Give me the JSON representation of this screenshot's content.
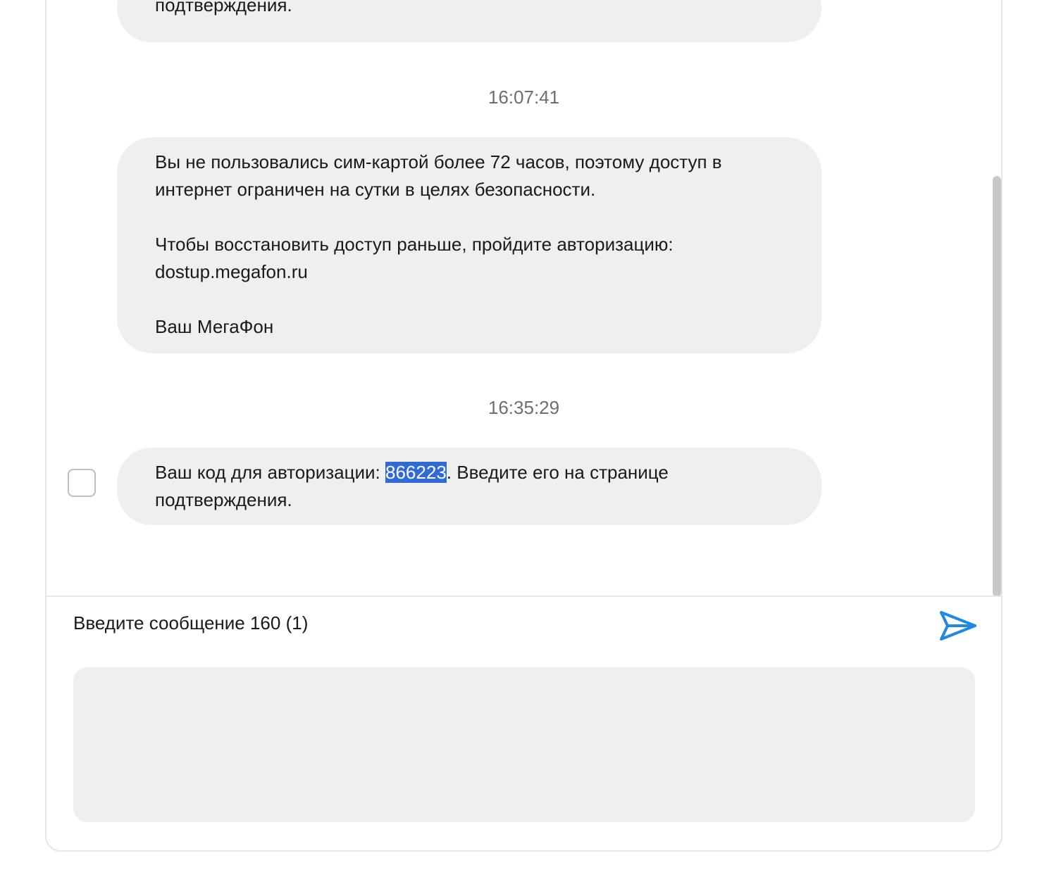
{
  "messages": [
    {
      "text": "подтверждения."
    },
    {
      "timestamp": "16:07:41",
      "paragraphs": [
        "Вы не пользовались сим-картой более 72 часов, поэтому доступ в интернет ограничен на сутки в целях безопасности.",
        "Чтобы восстановить доступ раньше, пройдите авторизацию: dostup.megafon.ru",
        "Ваш МегаФон"
      ]
    },
    {
      "timestamp": "16:35:29",
      "text_before": "Ваш код для авторизации: ",
      "code": "866223",
      "text_after": ". Введите его на странице подтверждения.",
      "selected": false
    }
  ],
  "compose": {
    "label": "Введите сообщение 160 (1)",
    "value": "",
    "send_icon": "send-icon",
    "accent_color": "#1e88e5"
  },
  "colors": {
    "bubble": "#efefef",
    "highlight": "#2f6bd8",
    "timestamp": "#6e6e6e"
  }
}
